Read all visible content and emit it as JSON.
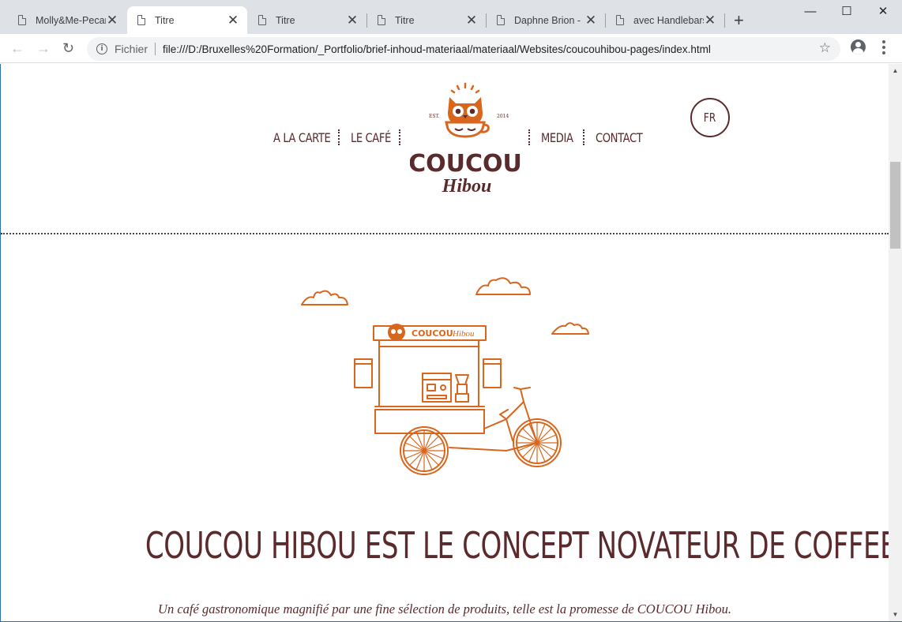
{
  "browser": {
    "tabs": [
      {
        "title": "Molly&Me-Pecan",
        "active": false
      },
      {
        "title": "Titre",
        "active": true
      },
      {
        "title": "Titre",
        "active": false
      },
      {
        "title": "Titre",
        "active": false
      },
      {
        "title": "Daphne Brion - ",
        "active": false
      },
      {
        "title": "avec Handlebars",
        "active": false
      }
    ],
    "close_glyph": "✕",
    "new_tab_glyph": "+",
    "window_controls": {
      "minimize": "—",
      "maximize": "☐",
      "close": "✕"
    },
    "nav": {
      "back": "←",
      "forward": "→",
      "reload": "↻"
    },
    "address": {
      "scheme_label": "Fichier",
      "url": "file:///D:/Bruxelles%20Formation/_Portfolio/brief-inhoud-materiaal/materiaal/Websites/coucouhibou-pages/index.html"
    },
    "bookmark_glyph": "☆",
    "scroll_up_glyph": "▲",
    "scroll_down_glyph": "▼"
  },
  "site": {
    "nav_left": [
      "A LA CARTE",
      "LE CAFÉ"
    ],
    "nav_right": [
      "MEDIA",
      "CONTACT"
    ],
    "logo": {
      "wordmark": "COUCOU",
      "script": "Hibou",
      "est_left": "EST.",
      "est_right": "2014"
    },
    "cart_sign": {
      "wordmark": "COUCOU",
      "script": "Hibou"
    },
    "language_button": "FR",
    "hero_title": "COUCOU HIBOU EST LE CONCEPT NOVATEUR DE COFFEE-BAR.",
    "hero_subtitle": "Un café gastronomique magnifié par une fine sélection de produits, telle est la promesse de COUCOU Hibou."
  },
  "colors": {
    "brand_brown": "#5b2a2c",
    "brand_orange": "#d8661c",
    "tabstrip": "#dee1e6"
  }
}
